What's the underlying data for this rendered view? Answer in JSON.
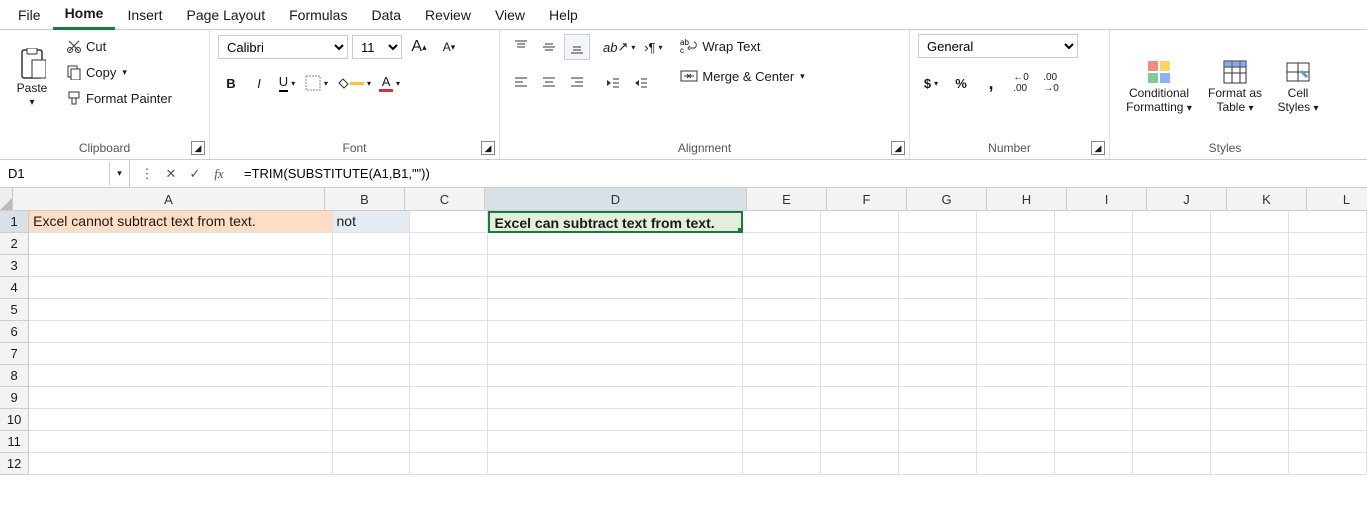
{
  "tabs": {
    "file": "File",
    "home": "Home",
    "insert": "Insert",
    "page_layout": "Page Layout",
    "formulas": "Formulas",
    "data": "Data",
    "review": "Review",
    "view": "View",
    "help": "Help"
  },
  "ribbon": {
    "clipboard": {
      "paste": "Paste",
      "cut": "Cut",
      "copy": "Copy",
      "format_painter": "Format Painter",
      "label": "Clipboard"
    },
    "font": {
      "name": "Calibri",
      "size": "11",
      "bold": "B",
      "italic": "I",
      "underline": "U",
      "label": "Font"
    },
    "alignment": {
      "wrap": "Wrap Text",
      "merge": "Merge & Center",
      "label": "Alignment"
    },
    "number": {
      "format": "General",
      "label": "Number"
    },
    "styles": {
      "cond_fmt1": "Conditional",
      "cond_fmt2": "Formatting",
      "fmt_tbl1": "Format as",
      "fmt_tbl2": "Table",
      "cell_st1": "Cell",
      "cell_st2": "Styles",
      "label": "Styles"
    }
  },
  "name_box": "D1",
  "formula": "=TRIM(SUBSTITUTE(A1,B1,\"\"))",
  "columns": [
    "A",
    "B",
    "C",
    "D",
    "E",
    "F",
    "G",
    "H",
    "I",
    "J",
    "K",
    "L"
  ],
  "row_count": 12,
  "cells": {
    "A1": "Excel cannot subtract text from text.",
    "B1": "not",
    "D1": "Excel can subtract text from text."
  },
  "selected_cell": "D1"
}
